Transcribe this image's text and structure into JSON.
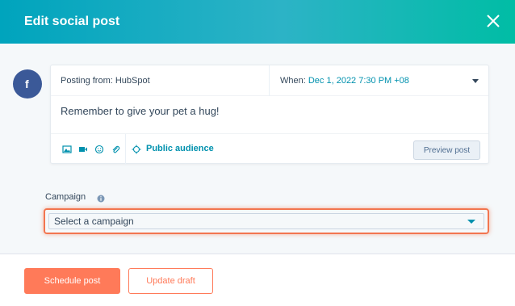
{
  "dialog": {
    "title": "Edit social post"
  },
  "post": {
    "posting_from": "Posting from: HubSpot",
    "when_label": "When:",
    "when_value": "Dec 1, 2022 7:30 PM +08",
    "message": "Remember to give your pet a hug!",
    "audience": "Public audience",
    "preview_label": "Preview post",
    "network_icon": "facebook-icon"
  },
  "campaign": {
    "label": "Campaign",
    "selected": "Select a campaign"
  },
  "footer": {
    "schedule_label": "Schedule post",
    "draft_label": "Update draft"
  },
  "colors": {
    "header_start": "#00a4bd",
    "header_end": "#00bda5",
    "accent": "#ff7a59",
    "link": "#0091ae",
    "facebook": "#3b5998",
    "highlight": "#f2754f"
  }
}
